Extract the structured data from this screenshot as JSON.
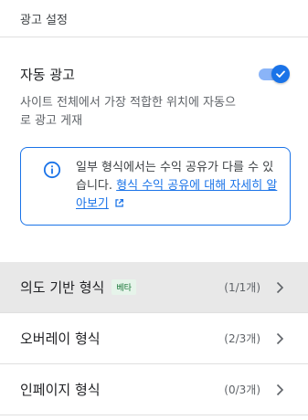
{
  "header": {
    "title": "광고 설정"
  },
  "auto_ads": {
    "title": "자동 광고",
    "enabled": true,
    "description": "사이트 전체에서 가장 적합한 위치에 자동으로 광고 게재"
  },
  "info": {
    "text": "일부 형식에서는 수익 공유가 다를 수 있습니다. ",
    "link_text": "형식 수익 공유에 대해 자세히 알아보기"
  },
  "formats": [
    {
      "label": "의도 기반 형식",
      "badge": "베타",
      "count": "(1/1개)"
    },
    {
      "label": "오버레이 형식",
      "count": "(2/3개)"
    },
    {
      "label": "인페이지 형식",
      "count": "(0/3개)"
    }
  ],
  "colors": {
    "accent": "#1a73e8",
    "toggle_track": "#8ab4f8",
    "highlight_row": "#e8e8e8"
  }
}
